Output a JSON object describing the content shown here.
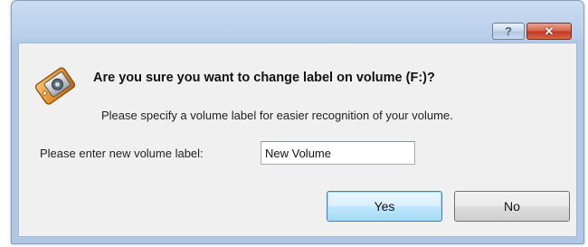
{
  "dialog": {
    "help_glyph": "?",
    "close_glyph": "✕",
    "icon": "volume-label-icon",
    "question": "Are you sure you want to change label on volume (F:)?",
    "subtext": "Please specify a volume label for easier recognition of your volume.",
    "input_label": "Please enter new volume label:",
    "input_value": "New Volume",
    "yes_label": "Yes",
    "no_label": "No"
  },
  "colors": {
    "titlebar": "#b7cfe9",
    "client_bg": "#f0f0f0",
    "close_button": "#c2391f",
    "default_button_border": "#3c7fb1"
  }
}
